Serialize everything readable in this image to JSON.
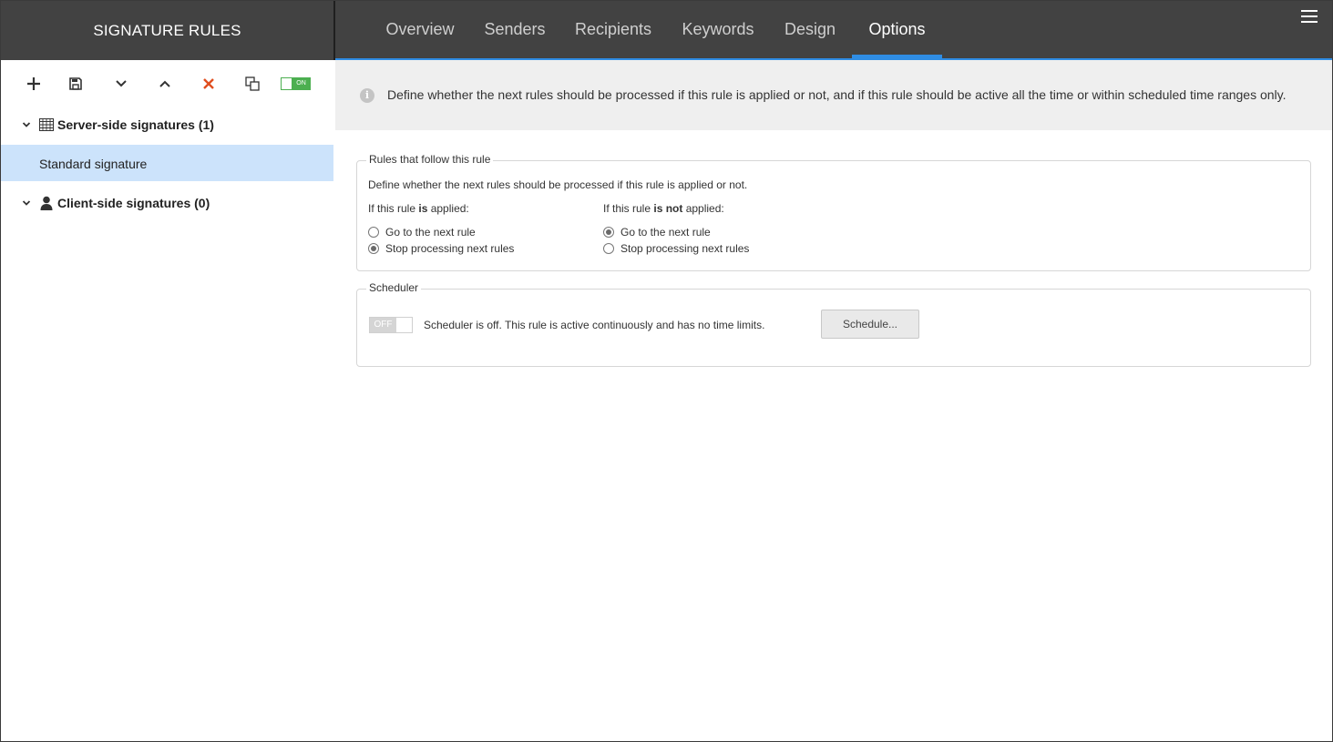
{
  "sidebar": {
    "title": "SIGNATURE RULES",
    "toolbar": {
      "add_icon": "plus-icon",
      "save_icon": "save-icon",
      "move_down_icon": "chevron-down-icon",
      "move_up_icon": "chevron-up-icon",
      "delete_icon": "close-icon",
      "duplicate_icon": "duplicate-icon",
      "toggle_label": "ON",
      "delete_color": "#e04e1f",
      "toggle_color": "#4caf50"
    },
    "groups": [
      {
        "label": "Server-side signatures (1)",
        "icon": "server-icon",
        "items": [
          "Standard signature"
        ]
      },
      {
        "label": "Client-side signatures (0)",
        "icon": "user-icon",
        "items": []
      }
    ]
  },
  "nav": {
    "tabs": [
      "Overview",
      "Senders",
      "Recipients",
      "Keywords",
      "Design",
      "Options"
    ],
    "active_tab": "Options",
    "accent": "#2f8de4",
    "menu_icon": "hamburger-menu-icon"
  },
  "info": {
    "icon": "info-icon",
    "text": "Define whether the next rules should be processed if this rule is applied or not, and if this rule should be active all the time or within scheduled time ranges only."
  },
  "rules": {
    "legend": "Rules that follow this rule",
    "description": "Define whether the next rules should be processed if this rule is applied or not.",
    "applied": {
      "prefix": "If this rule ",
      "emph": "is",
      "suffix": " applied:",
      "options": [
        "Go to the next rule",
        "Stop processing next rules"
      ],
      "selected": "Stop processing next rules"
    },
    "not_applied": {
      "prefix": "If this rule ",
      "emph": "is not",
      "suffix": " applied:",
      "options": [
        "Go to the next rule",
        "Stop processing next rules"
      ],
      "selected": "Go to the next rule"
    }
  },
  "scheduler": {
    "legend": "Scheduler",
    "toggle_label": "OFF",
    "status_text": "Scheduler is off. This rule is active continuously and has no time limits.",
    "button_label": "Schedule..."
  }
}
